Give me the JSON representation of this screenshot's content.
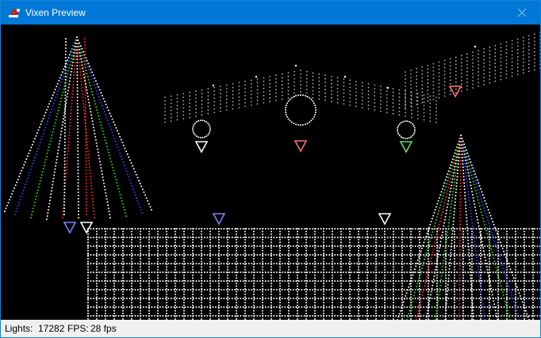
{
  "window": {
    "title": "Vixen Preview",
    "icons": {
      "app": "vixen-santa-hat-icon",
      "close": "close-icon"
    }
  },
  "colors": {
    "titlebar": "#0078d7",
    "preview_background": "#000000",
    "light_white": "#ffffff",
    "light_red": "#ff2020",
    "light_green": "#20d020",
    "light_blue": "#2840ff",
    "light_gray": "#b0b0b0",
    "indicator_red": "#ff7070",
    "indicator_green": "#60e060",
    "indicator_blue": "#8080ff",
    "indicator_white": "#ffffff"
  },
  "preview": {
    "element_icons": "triangle-marker-icon"
  },
  "status": {
    "lights_label": "Lights:",
    "lights_value": "17282",
    "fps_label": "FPS:",
    "fps_value": "28 fps"
  }
}
